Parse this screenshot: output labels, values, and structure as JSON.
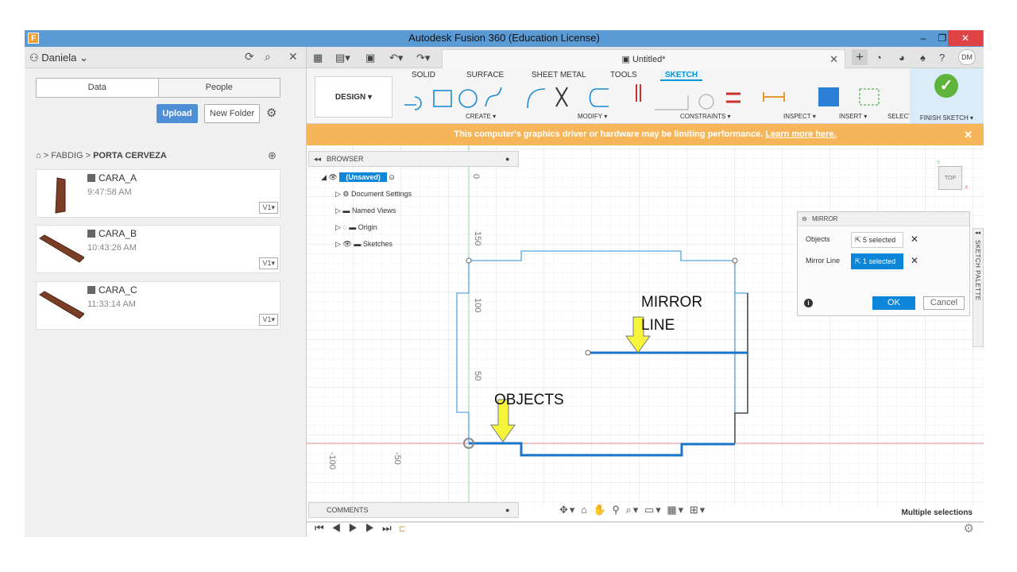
{
  "window": {
    "title": "Autodesk Fusion 360 (Education License)",
    "app_icon": "F",
    "minimize": "–",
    "maximize": "❐",
    "close": "✕"
  },
  "left_panel": {
    "user": "Daniela",
    "tabs": [
      "Data",
      "People"
    ],
    "upload_label": "Upload",
    "new_folder_label": "New Folder",
    "breadcrumb": [
      "FABDIG",
      "PORTA CERVEZA"
    ],
    "files": [
      {
        "name": "CARA_A",
        "time": "9:47:58 AM",
        "version": "V1▾"
      },
      {
        "name": "CARA_B",
        "time": "10:43:26 AM",
        "version": "V1▾"
      },
      {
        "name": "CARA_C",
        "time": "11:33:14 AM",
        "version": "V1▾"
      }
    ]
  },
  "appbar": {
    "doc_title": "Untitled*",
    "avatar": "DM"
  },
  "ribbon": {
    "workspace": "DESIGN ▾",
    "tabs": [
      "SOLID",
      "SURFACE",
      "SHEET METAL",
      "TOOLS",
      "SKETCH"
    ],
    "active_tab": "SKETCH",
    "groups": [
      "CREATE ▾",
      "MODIFY ▾",
      "CONSTRAINTS ▾",
      "INSPECT ▾",
      "INSERT ▾",
      "SELECT ▾"
    ],
    "finish_label": "FINISH SKETCH ▾",
    "accent": "#0696d7"
  },
  "warning": {
    "text": "This computer's graphics driver or hardware may be limiting performance.",
    "link": "Learn more here.",
    "close": "✕"
  },
  "browser": {
    "title": "BROWSER",
    "root": "(Unsaved)",
    "items": [
      "Document Settings",
      "Named Views",
      "Origin",
      "Sketches"
    ]
  },
  "mirror_dialog": {
    "title": "MIRROR",
    "objects_label": "Objects",
    "objects_value": "5 selected",
    "mirror_line_label": "Mirror Line",
    "mirror_line_value": "1 selected",
    "ok": "OK",
    "cancel": "Cancel"
  },
  "sketch_palette": "SKETCH PALETTE",
  "viewcube": {
    "face": "TOP",
    "x_axis": "X",
    "y_axis": "Y"
  },
  "rulers": {
    "v0": "0",
    "v150": "150",
    "v100": "100",
    "v50": "50",
    "h100": "-100",
    "h50": "-50"
  },
  "annotations": {
    "mirror_line_1": "MIRROR",
    "mirror_line_2": "LINE",
    "objects": "OBJECTS"
  },
  "comments_label": "COMMENTS",
  "status": "Multiple selections"
}
